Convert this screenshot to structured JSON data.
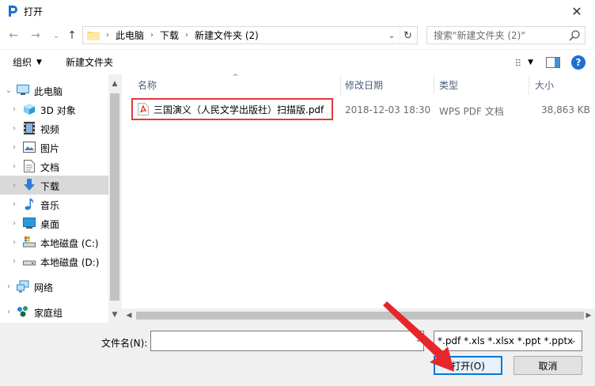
{
  "window": {
    "title": "打开",
    "close_glyph": "✕"
  },
  "nav": {
    "back_glyph": "←",
    "forward_glyph": "→",
    "recent_glyph": "⌄",
    "up_glyph": "↑",
    "breadcrumbs": [
      "此电脑",
      "下载",
      "新建文件夹 (2)"
    ],
    "crumb_separator": "›",
    "dropdown_glyph": "⌄",
    "refresh_glyph": "↻",
    "search_placeholder": "搜索\"新建文件夹 (2)\""
  },
  "toolbar": {
    "organize_label": "组织",
    "organize_caret": "▼",
    "new_folder_label": "新建文件夹",
    "view_caret": "▼",
    "help_glyph": "?"
  },
  "navpane": {
    "items": [
      {
        "label": "此电脑",
        "icon": "computer-icon",
        "level": 0,
        "expanded": true
      },
      {
        "label": "3D 对象",
        "icon": "3d-objects-icon",
        "level": 1
      },
      {
        "label": "视频",
        "icon": "video-icon",
        "level": 1
      },
      {
        "label": "图片",
        "icon": "picture-icon",
        "level": 1
      },
      {
        "label": "文档",
        "icon": "document-icon",
        "level": 1
      },
      {
        "label": "下载",
        "icon": "download-icon",
        "level": 1,
        "selected": true
      },
      {
        "label": "音乐",
        "icon": "music-icon",
        "level": 1
      },
      {
        "label": "桌面",
        "icon": "desktop-icon",
        "level": 1
      },
      {
        "label": "本地磁盘 (C:)",
        "icon": "drive-c-icon",
        "level": 1
      },
      {
        "label": "本地磁盘 (D:)",
        "icon": "drive-d-icon",
        "level": 1
      },
      {
        "label": "网络",
        "icon": "network-icon",
        "level": 0
      },
      {
        "label": "家庭组",
        "icon": "homegroup-icon",
        "level": 0
      }
    ],
    "chevron_right": "›",
    "chevron_down": "⌄",
    "scroll_up": "▲",
    "scroll_down": "▼"
  },
  "filelist": {
    "columns": [
      "名称",
      "修改日期",
      "类型",
      "大小"
    ],
    "sort_glyph": "^",
    "files": [
      {
        "name": "三国演义（人民文学出版社）扫描版.pdf",
        "modified": "2018-12-03 18:30",
        "type": "WPS PDF 文档",
        "size": "38,863 KB",
        "icon": "pdf-file-icon"
      }
    ],
    "scroll_left": "◀",
    "scroll_right": "▶"
  },
  "footer": {
    "filename_label": "文件名(N):",
    "filename_value": "",
    "filename_caret": "⌄",
    "filetype_value": "*.pdf *.xls *.xlsx *.ppt *.pptx",
    "filetype_caret": "⌄",
    "open_label": "打开(O)",
    "cancel_label": "取消"
  },
  "colors": {
    "accent": "#0078d7",
    "highlight": "#e03c3c",
    "selected_bg": "#d9d9d9"
  }
}
